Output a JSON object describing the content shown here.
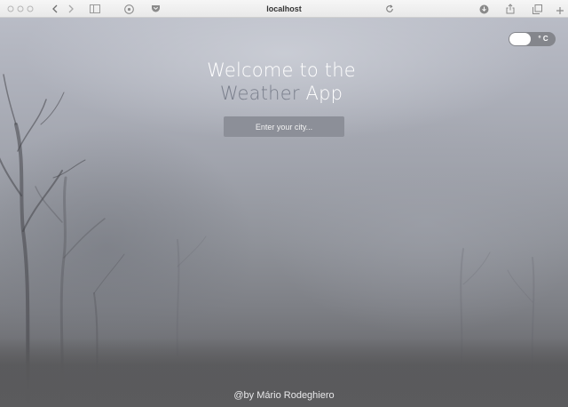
{
  "browser": {
    "address": "localhost",
    "icons": {
      "sidebar": "sidebar-icon",
      "back": "chevron-left-icon",
      "forward": "chevron-right-icon",
      "reader": "reader-icon",
      "extension": "extension-icon",
      "pocket": "pocket-icon",
      "reload": "reload-icon",
      "download": "download-icon",
      "share": "share-icon",
      "tabs": "tabs-icon",
      "new_tab": "plus-icon"
    }
  },
  "app": {
    "unit_toggle": {
      "label": "° C",
      "state": "on"
    },
    "title_line1": "Welcome to the",
    "title_word_accent": "Weather",
    "title_word_rest": " App",
    "city_input": {
      "placeholder": "Enter your city...",
      "value": ""
    },
    "credit": "@by Mário Rodeghiero"
  },
  "colors": {
    "title_text": "#ffffff",
    "title_accent": "#7a7f8c",
    "input_bg": "#8c8f98",
    "toggle_bg": "#84868c"
  }
}
